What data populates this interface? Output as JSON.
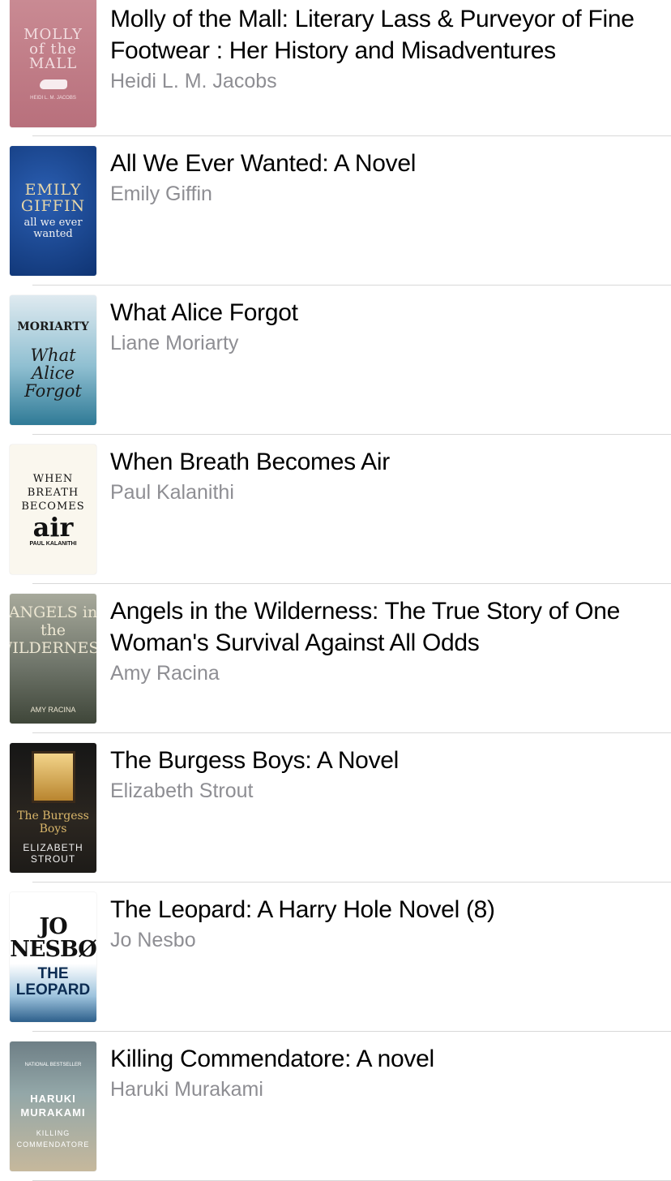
{
  "books": [
    {
      "title": "Molly of the Mall: Literary Lass & Purveyor of Fine Footwear : Her History and Misadventures",
      "author": "Heidi L. M. Jacobs",
      "cover": {
        "line1": "MOLLY of the MALL",
        "line2": "HEIDI L. M. JACOBS"
      }
    },
    {
      "title": "All We Ever Wanted: A Novel",
      "author": "Emily Giffin",
      "cover": {
        "line1": "EMILY GIFFIN",
        "line2": "all we ever wanted"
      }
    },
    {
      "title": "What Alice Forgot",
      "author": "Liane Moriarty",
      "cover": {
        "line1": "MORIARTY",
        "line2": "What Alice Forgot"
      }
    },
    {
      "title": "When Breath Becomes Air",
      "author": "Paul Kalanithi",
      "cover": {
        "line1": "WHEN BREATH BECOMES",
        "line2": "air",
        "line3": "PAUL KALANITHI"
      }
    },
    {
      "title": "Angels in the Wilderness: The True Story of One Woman's Survival Against All Odds",
      "author": "Amy Racina",
      "cover": {
        "line1": "ANGELS in the WILDERNESS",
        "line2": "AMY RACINA"
      }
    },
    {
      "title": "The Burgess Boys: A Novel",
      "author": "Elizabeth Strout",
      "cover": {
        "line1": "The Burgess Boys",
        "line2": "ELIZABETH STROUT"
      }
    },
    {
      "title": "The Leopard: A Harry Hole Novel (8)",
      "author": "Jo Nesbo",
      "cover": {
        "line1": "JO NESBØ",
        "line2": "THE LEOPARD"
      }
    },
    {
      "title": "Killing Commendatore: A novel",
      "author": "Haruki Murakami",
      "cover": {
        "line0": "NATIONAL BESTSELLER",
        "line1": "HARUKI MURAKAMI",
        "line2": "KILLING COMMENDATORE"
      }
    }
  ]
}
